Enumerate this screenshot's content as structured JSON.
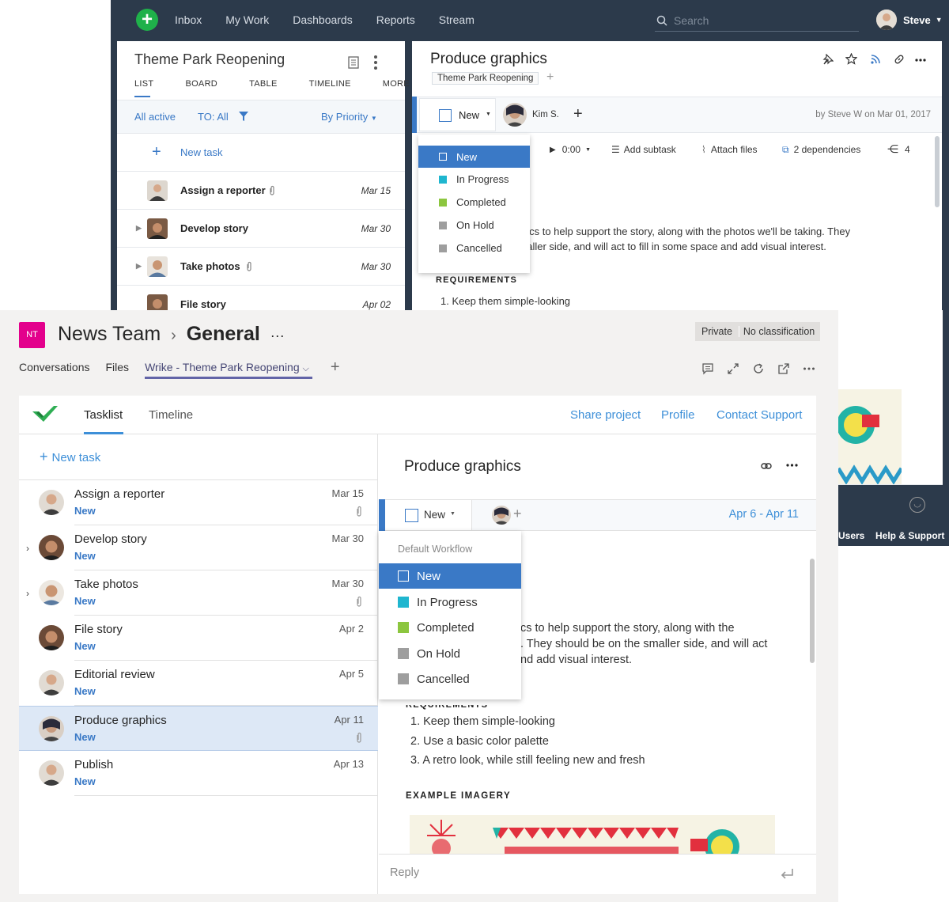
{
  "wrike": {
    "nav": [
      "Inbox",
      "My Work",
      "Dashboards",
      "Reports",
      "Stream"
    ],
    "search_placeholder": "Search",
    "user_name": "Steve",
    "project_title": "Theme Park Reopening",
    "view_tabs": [
      "LIST",
      "BOARD",
      "TABLE",
      "TIMELINE",
      "MORE"
    ],
    "filter_all_active": "All active",
    "filter_to": "TO: All",
    "sort": "By Priority",
    "new_task": "New task",
    "tasks": [
      {
        "title": "Assign a reporter",
        "date": "Mar 15"
      },
      {
        "title": "Develop story",
        "date": "Mar 30"
      },
      {
        "title": "Take photos",
        "date": "Mar 30"
      },
      {
        "title": "File story",
        "date": "Apr 02"
      }
    ],
    "detail": {
      "title": "Produce graphics",
      "project_tag": "Theme Park Reopening",
      "status": "New",
      "assignee": "Kim S.",
      "byline": "by Steve W on Mar 01, 2017",
      "timer": "0:00",
      "add_subtask": "Add subtask",
      "attach_files": "Attach files",
      "dependencies": "2 dependencies",
      "share_count": "4",
      "desc_line1": "hics to help support the story, along with the photos we'll be taking. They",
      "desc_line2": "naller side, and will act to fill in some space and add visual interest.",
      "requirements_heading": "REQUIREMENTS",
      "req1": "1. Keep them simple-looking"
    },
    "status_options": [
      {
        "label": "New",
        "color": "#3a79c6"
      },
      {
        "label": "In Progress",
        "color": "#1fb6cf"
      },
      {
        "label": "Completed",
        "color": "#8cc63f"
      },
      {
        "label": "On Hold",
        "color": "#9e9e9e"
      },
      {
        "label": "Cancelled",
        "color": "#9e9e9e"
      }
    ],
    "footer_users": "Users",
    "footer_help": "Help & Support"
  },
  "teams": {
    "team_badge": "NT",
    "team_name": "News Team",
    "channel_name": "General",
    "private_label": "Private",
    "classification_label": "No classification",
    "tabs": [
      "Conversations",
      "Files",
      "Wrike - Theme Park Reopening"
    ],
    "app": {
      "tab_tasklist": "Tasklist",
      "tab_timeline": "Timeline",
      "share_project": "Share project",
      "profile": "Profile",
      "contact_support": "Contact Support",
      "new_task": "New task",
      "tasks": [
        {
          "title": "Assign a reporter",
          "status": "New",
          "date": "Mar 15"
        },
        {
          "title": "Develop story",
          "status": "New",
          "date": "Mar 30"
        },
        {
          "title": "Take photos",
          "status": "New",
          "date": "Mar 30"
        },
        {
          "title": "File story",
          "status": "New",
          "date": "Apr 2"
        },
        {
          "title": "Editorial review",
          "status": "New",
          "date": "Apr 5"
        },
        {
          "title": "Produce graphics",
          "status": "New",
          "date": "Apr 11"
        },
        {
          "title": "Publish",
          "status": "New",
          "date": "Apr 13"
        }
      ],
      "detail": {
        "title": "Produce graphics",
        "status": "New",
        "date_range": "Apr 6 - Apr 11",
        "workflow_label": "Default Workflow",
        "desc_line1": "cs to help support the story, along with the",
        "desc_line2": ". They should be on the smaller side, and will act",
        "desc_line3": "nd add visual interest.",
        "requirements": [
          "1. Keep them simple-looking",
          "2. Use a basic color palette",
          "3. A retro look, while still feeling new and fresh"
        ],
        "example_heading": "EXAMPLE IMAGERY",
        "reply_placeholder": "Reply"
      }
    }
  }
}
